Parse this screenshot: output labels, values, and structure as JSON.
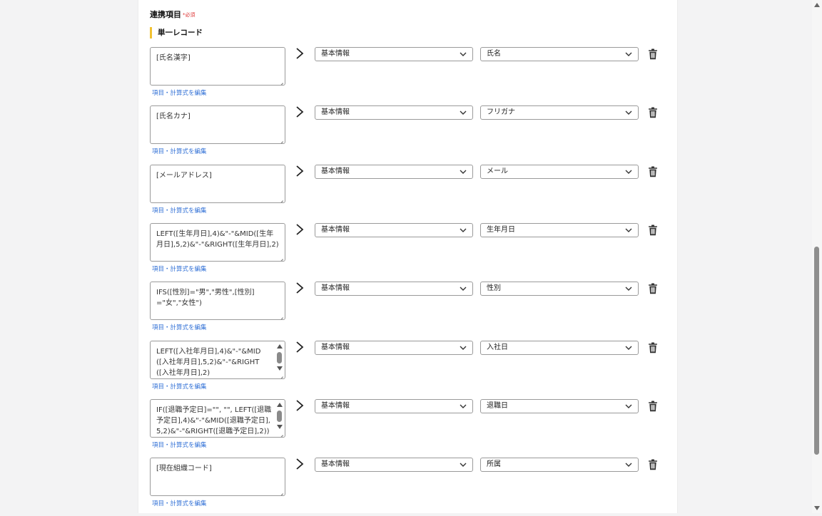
{
  "section": {
    "title": "連携項目",
    "required": "*必須",
    "subheading": "単一レコード"
  },
  "rows": [
    {
      "formula": "[氏名漢字]",
      "scroll": false,
      "edit_label": "項目・計算式を編集",
      "category": "基本情報",
      "field": "氏名"
    },
    {
      "formula": "[氏名カナ]",
      "scroll": false,
      "edit_label": "項目・計算式を編集",
      "category": "基本情報",
      "field": "フリガナ"
    },
    {
      "formula": "[メールアドレス]",
      "scroll": false,
      "edit_label": "項目・計算式を編集",
      "category": "基本情報",
      "field": "メール"
    },
    {
      "formula": "LEFT([生年月日],4)&\"-\"&MID([生年月日],5,2)&\"-\"&RIGHT([生年月日],2)",
      "scroll": false,
      "edit_label": "項目・計算式を編集",
      "category": "基本情報",
      "field": "生年月日"
    },
    {
      "formula": "IFS([性別]=\"男\",\"男性\",[性別]=\"女\",\"女性\")",
      "scroll": false,
      "edit_label": "項目・計算式を編集",
      "category": "基本情報",
      "field": "性別"
    },
    {
      "formula": "LEFT([入社年月日],4)&\"-\"&MID([入社年月日],5,2)&\"-\"&RIGHT([入社年月日],2)",
      "scroll": true,
      "edit_label": "項目・計算式を編集",
      "category": "基本情報",
      "field": "入社日"
    },
    {
      "formula": "IF([退職予定日]=\"\", \"\", LEFT([退職予定日],4)&\"-\"&MID([退職予定日],5,2)&\"-\"&RIGHT([退職予定日],2))",
      "scroll": true,
      "edit_label": "項目・計算式を編集",
      "category": "基本情報",
      "field": "退職日"
    },
    {
      "formula": "[現在組織コード]",
      "scroll": false,
      "edit_label": "項目・計算式を編集",
      "category": "基本情報",
      "field": "所属"
    }
  ]
}
